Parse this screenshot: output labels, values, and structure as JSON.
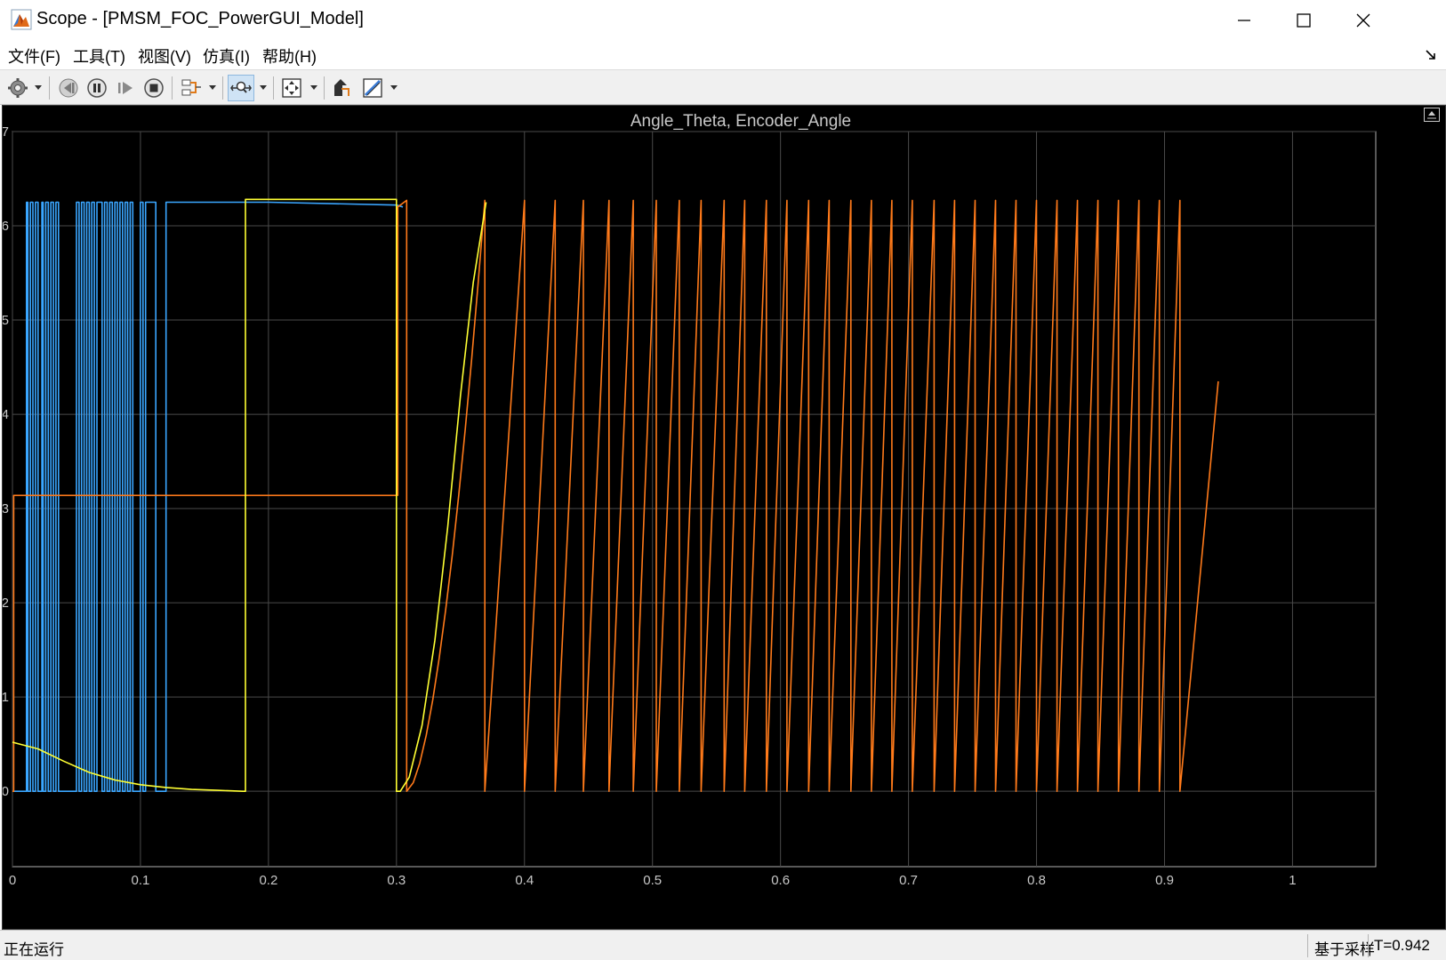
{
  "window": {
    "title": "Scope - [PMSM_FOC_PowerGUI_Model]"
  },
  "menu": {
    "items": [
      "文件(F)",
      "工具(T)",
      "视图(V)",
      "仿真(I)",
      "帮助(H)"
    ]
  },
  "toolbar": {
    "icons": [
      "settings-icon",
      "step-back-icon",
      "pause-icon",
      "step-forward-icon",
      "stop-icon",
      "signal-selector-icon",
      "zoom-icon",
      "autoscale-icon",
      "highlight-block-icon",
      "measurements-icon"
    ],
    "active": "zoom-icon"
  },
  "status": {
    "left": "正在运行",
    "sample_mode": "基于采样",
    "time": "T=0.942"
  },
  "colors": {
    "background": "#000000",
    "grid": "#4a4a4a",
    "tick_text": "#c8c8c8",
    "series_blue": "#3aa6ff",
    "series_yellow": "#ffff33",
    "series_orange": "#ff7a1a"
  },
  "chart_data": {
    "type": "line",
    "title": "Angle_Theta, Encoder_Angle",
    "xlabel": "",
    "ylabel": "",
    "xlim": [
      0,
      1.065
    ],
    "ylim": [
      -0.8,
      7.0
    ],
    "xticks": [
      "0",
      "0.1",
      "0.2",
      "0.3",
      "0.4",
      "0.5",
      "0.6",
      "0.7",
      "0.8",
      "0.9",
      "1"
    ],
    "yticks": [
      "0",
      "1",
      "2",
      "3",
      "4",
      "5",
      "6",
      "7"
    ],
    "grid": true,
    "series": [
      {
        "color": "#3aa6ff",
        "style": "square-wave",
        "x": [
          0,
          0.011,
          0.011,
          0.012,
          0.012,
          0.014,
          0.014,
          0.016,
          0.016,
          0.018,
          0.018,
          0.02,
          0.02,
          0.023,
          0.023,
          0.024,
          0.024,
          0.026,
          0.026,
          0.028,
          0.028,
          0.03,
          0.03,
          0.032,
          0.032,
          0.034,
          0.034,
          0.036,
          0.036,
          0.05,
          0.05,
          0.052,
          0.052,
          0.054,
          0.054,
          0.056,
          0.056,
          0.058,
          0.058,
          0.06,
          0.06,
          0.062,
          0.062,
          0.064,
          0.064,
          0.066,
          0.066,
          0.07,
          0.07,
          0.072,
          0.072,
          0.074,
          0.074,
          0.076,
          0.076,
          0.078,
          0.078,
          0.08,
          0.08,
          0.082,
          0.082,
          0.084,
          0.084,
          0.086,
          0.086,
          0.088,
          0.088,
          0.09,
          0.09,
          0.092,
          0.092,
          0.094,
          0.094,
          0.1,
          0.1,
          0.102,
          0.102,
          0.104,
          0.104,
          0.112,
          0.112,
          0.12,
          0.12,
          0.2,
          0.3,
          0.305,
          0.305
        ],
        "y": [
          0,
          0,
          6.25,
          6.25,
          0,
          0,
          6.25,
          6.25,
          0,
          0,
          6.25,
          6.25,
          0,
          0,
          6.25,
          6.25,
          0,
          0,
          6.25,
          6.25,
          0,
          0,
          6.25,
          6.25,
          0,
          0,
          6.25,
          6.25,
          0,
          0,
          6.25,
          6.25,
          0,
          0,
          6.25,
          6.25,
          0,
          0,
          6.25,
          6.25,
          0,
          0,
          6.25,
          6.25,
          0,
          0,
          6.25,
          6.25,
          0,
          0,
          6.25,
          6.25,
          0,
          0,
          6.25,
          6.25,
          0,
          0,
          6.25,
          6.25,
          0,
          0,
          6.25,
          6.25,
          0,
          0,
          6.25,
          6.25,
          0,
          0,
          6.25,
          6.25,
          0,
          0,
          6.25,
          6.25,
          0,
          0,
          6.25,
          6.25,
          0,
          0,
          6.25,
          6.25,
          6.22,
          6.2,
          6.2
        ]
      },
      {
        "color": "#ffff33",
        "style": "line",
        "x": [
          0,
          0.02,
          0.04,
          0.06,
          0.08,
          0.1,
          0.12,
          0.14,
          0.16,
          0.18,
          0.182,
          0.182,
          0.3,
          0.3,
          0.303,
          0.31,
          0.32,
          0.33,
          0.34,
          0.35,
          0.36,
          0.37
        ],
        "y": [
          0.52,
          0.45,
          0.32,
          0.2,
          0.12,
          0.07,
          0.04,
          0.02,
          0.01,
          0.0,
          0.0,
          6.28,
          6.28,
          0.0,
          0.0,
          0.15,
          0.7,
          1.6,
          2.8,
          4.2,
          5.4,
          6.25
        ]
      },
      {
        "color": "#ff7a1a",
        "style": "sawtooth",
        "x_start": 0,
        "initial_hold": [
          [
            0,
            0
          ],
          [
            0.001,
            0
          ],
          [
            0.001,
            3.14
          ],
          [
            0.301,
            3.14
          ],
          [
            0.301,
            6.2
          ],
          [
            0.308,
            6.27
          ],
          [
            0.308,
            0
          ]
        ],
        "peak_x": [
          0.369,
          0.4,
          0.424,
          0.446,
          0.466,
          0.485,
          0.503,
          0.521,
          0.538,
          0.556,
          0.572,
          0.589,
          0.605,
          0.622,
          0.638,
          0.655,
          0.671,
          0.687,
          0.703,
          0.72,
          0.736,
          0.752,
          0.768,
          0.784,
          0.8,
          0.816,
          0.832,
          0.848,
          0.864,
          0.88,
          0.896,
          0.912
        ],
        "peak_y": 6.27,
        "end_x": 0.942,
        "end_y": 4.35
      }
    ]
  }
}
